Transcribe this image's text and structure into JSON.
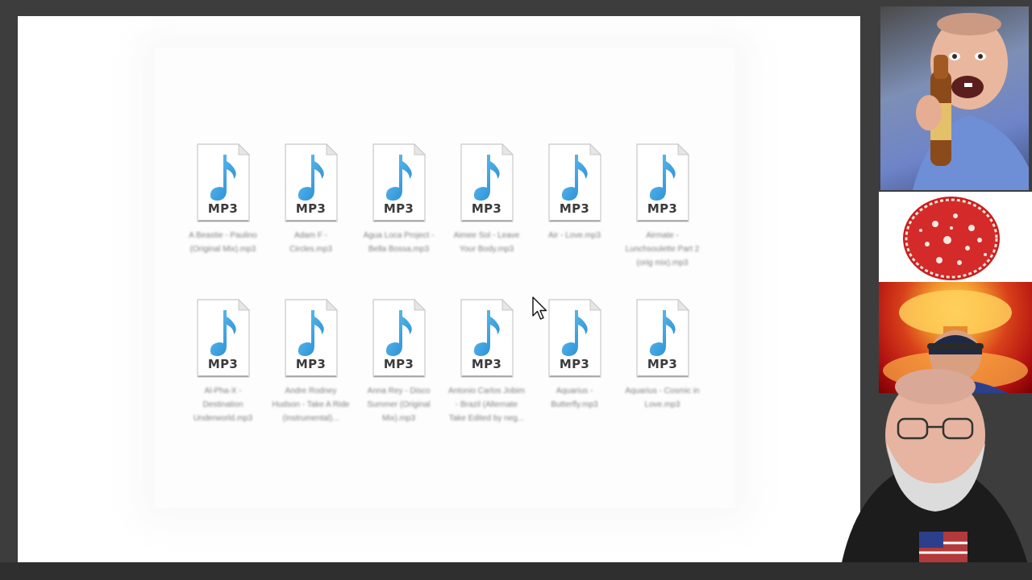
{
  "window": {
    "view": "large-icons"
  },
  "files": [
    {
      "type_label": "MP3",
      "name": "A Beastie - Paulino (Original Mix).mp3"
    },
    {
      "type_label": "MP3",
      "name": "Adam F - Circles.mp3"
    },
    {
      "type_label": "MP3",
      "name": "Agua Loca Project - Bella Bossa.mp3"
    },
    {
      "type_label": "MP3",
      "name": "Aimee Sol - Leave Your Body.mp3"
    },
    {
      "type_label": "MP3",
      "name": "Air - Love.mp3"
    },
    {
      "type_label": "MP3",
      "name": "Airmate - Lunchsoulette Part 2 (orig mix).mp3"
    },
    {
      "type_label": "MP3",
      "name": "Al-Pha-X - Destination Underworld.mp3"
    },
    {
      "type_label": "MP3",
      "name": "Andre Rodney Hudson - Take A Ride (Instrumental)..."
    },
    {
      "type_label": "MP3",
      "name": "Anna Rey - Disco Summer (Original Mix).mp3"
    },
    {
      "type_label": "MP3",
      "name": "Antonio Carlos Jobim - Brazil (Alternate Take Edited by neg..."
    },
    {
      "type_label": "MP3",
      "name": "Aquarius - Butterfly.mp3"
    },
    {
      "type_label": "MP3",
      "name": "Aquarius - Cosmic in Love.mp3"
    }
  ],
  "colors": {
    "note_blue": "#2a9be0",
    "note_blue_light": "#6cc6f2",
    "page_fold": "#d9d9d9"
  },
  "icons": {
    "file": "mp3-file-icon",
    "pointer": "mouse-pointer-icon"
  },
  "webcams": [
    {
      "name": "webcam-guest-1"
    },
    {
      "name": "pizza-overlay"
    },
    {
      "name": "explosion-overlay-guest-2"
    },
    {
      "name": "webcam-host"
    }
  ]
}
